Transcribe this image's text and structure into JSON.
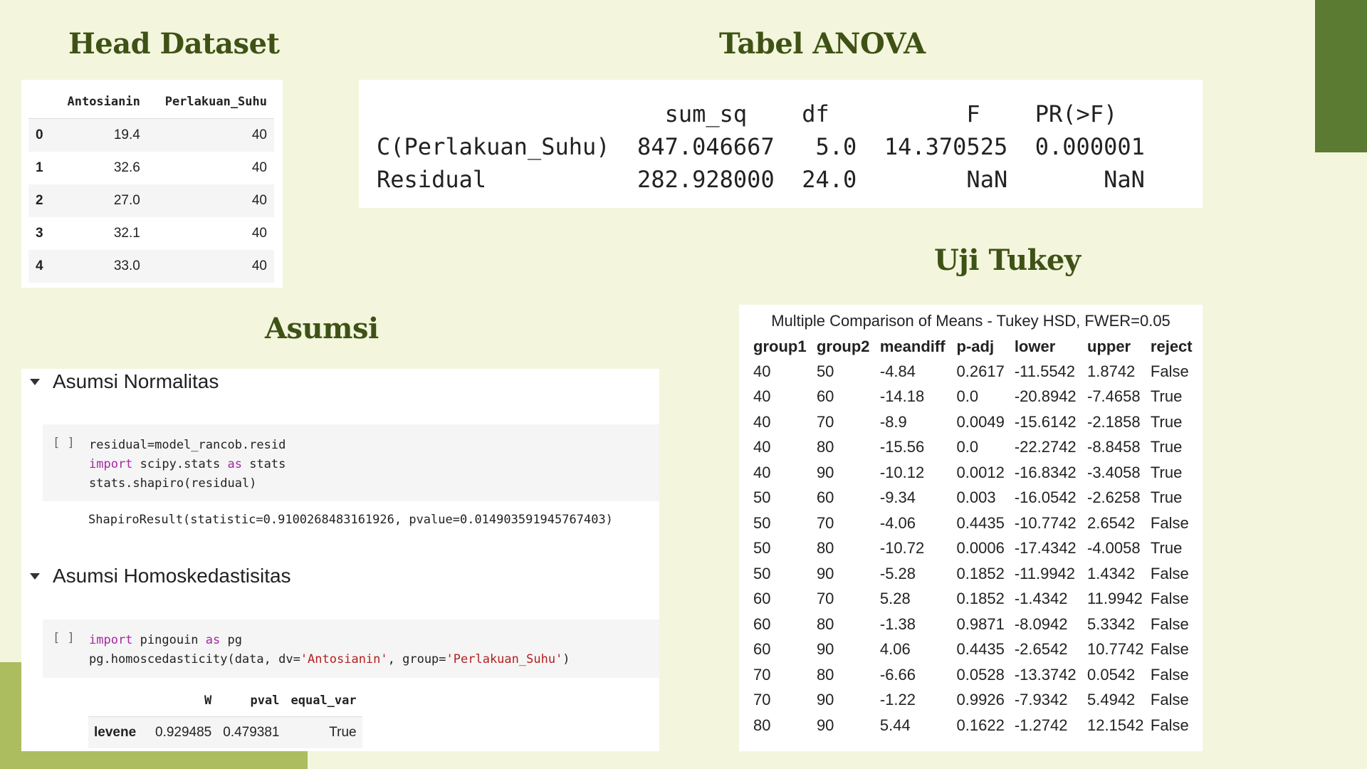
{
  "headings": {
    "head_dataset": "Head Dataset",
    "anova": "Tabel ANOVA",
    "tukey": "Uji Tukey",
    "asumsi": "Asumsi"
  },
  "head_dataset": {
    "columns": [
      "",
      "Antosianin",
      "Perlakuan_Suhu"
    ],
    "rows": [
      [
        "0",
        "19.4",
        "40"
      ],
      [
        "1",
        "32.6",
        "40"
      ],
      [
        "2",
        "27.0",
        "40"
      ],
      [
        "3",
        "32.1",
        "40"
      ],
      [
        "4",
        "33.0",
        "40"
      ]
    ]
  },
  "anova": {
    "text": "                     sum_sq    df          F    PR(>F)\nC(Perlakuan_Suhu)  847.046667   5.0  14.370525  0.000001\nResidual           282.928000  24.0        NaN       NaN"
  },
  "asumsi": {
    "normalitas": {
      "title": "Asumsi Normalitas",
      "run_label": "[ ]",
      "code_line1": "residual=model_rancob.resid",
      "kw_import": "import",
      "code_line2_mid": " scipy.stats ",
      "kw_as": "as",
      "code_line2_end": " stats",
      "code_line3": "stats.shapiro(residual)",
      "output": "ShapiroResult(statistic=0.9100268483161926, pvalue=0.014903591945767403)"
    },
    "homoskedastisitas": {
      "title": "Asumsi Homoskedastisitas",
      "run_label": "[ ]",
      "kw_import": "import",
      "code_line1_mid": " pingouin ",
      "kw_as": "as",
      "code_line1_end": " pg",
      "code_line2_a": "pg.homoscedasticity(data, dv=",
      "str_dv": "'Antosianin'",
      "code_line2_b": ", group=",
      "str_group": "'Perlakuan_Suhu'",
      "code_line2_c": ")",
      "table": {
        "columns": [
          "",
          "W",
          "pval",
          "equal_var"
        ],
        "row": [
          "levene",
          "0.929485",
          "0.479381",
          "True"
        ]
      }
    }
  },
  "tukey": {
    "caption": "Multiple Comparison of Means - Tukey HSD, FWER=0.05",
    "columns": [
      "group1",
      "group2",
      "meandiff",
      "p-adj",
      "lower",
      "upper",
      "reject"
    ],
    "rows": [
      [
        "40",
        "50",
        "-4.84",
        "0.2617",
        "-11.5542",
        "1.8742",
        "False"
      ],
      [
        "40",
        "60",
        "-14.18",
        "0.0",
        "-20.8942",
        "-7.4658",
        "True"
      ],
      [
        "40",
        "70",
        "-8.9",
        "0.0049",
        "-15.6142",
        "-2.1858",
        "True"
      ],
      [
        "40",
        "80",
        "-15.56",
        "0.0",
        "-22.2742",
        "-8.8458",
        "True"
      ],
      [
        "40",
        "90",
        "-10.12",
        "0.0012",
        "-16.8342",
        "-3.4058",
        "True"
      ],
      [
        "50",
        "60",
        "-9.34",
        "0.003",
        "-16.0542",
        "-2.6258",
        "True"
      ],
      [
        "50",
        "70",
        "-4.06",
        "0.4435",
        "-10.7742",
        "2.6542",
        "False"
      ],
      [
        "50",
        "80",
        "-10.72",
        "0.0006",
        "-17.4342",
        "-4.0058",
        "True"
      ],
      [
        "50",
        "90",
        "-5.28",
        "0.1852",
        "-11.9942",
        "1.4342",
        "False"
      ],
      [
        "60",
        "70",
        "5.28",
        "0.1852",
        "-1.4342",
        "11.9942",
        "False"
      ],
      [
        "60",
        "80",
        "-1.38",
        "0.9871",
        "-8.0942",
        "5.3342",
        "False"
      ],
      [
        "60",
        "90",
        "4.06",
        "0.4435",
        "-2.6542",
        "10.7742",
        "False"
      ],
      [
        "70",
        "80",
        "-6.66",
        "0.0528",
        "-13.3742",
        "0.0542",
        "False"
      ],
      [
        "70",
        "90",
        "-1.22",
        "0.9926",
        "-7.9342",
        "5.4942",
        "False"
      ],
      [
        "80",
        "90",
        "5.44",
        "0.1622",
        "-1.2742",
        "12.1542",
        "False"
      ]
    ]
  }
}
